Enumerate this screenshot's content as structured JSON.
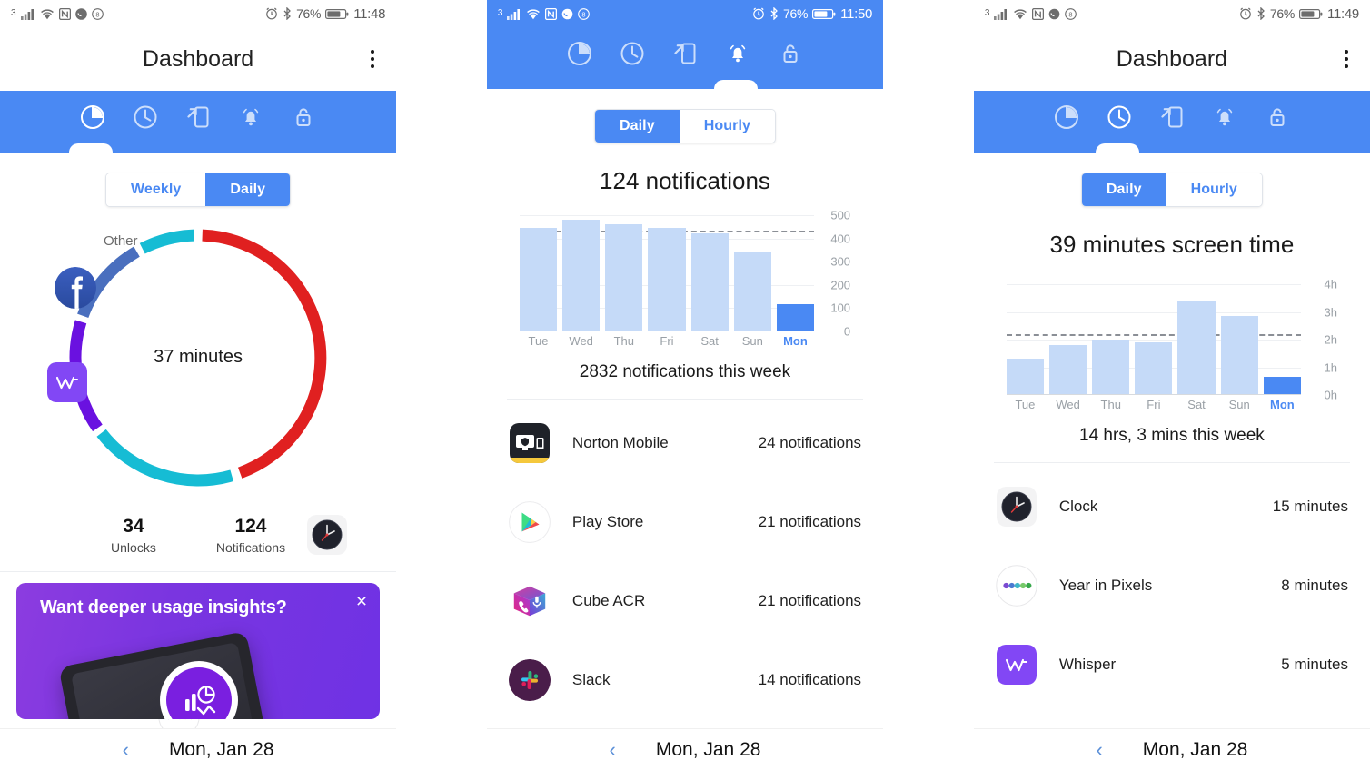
{
  "panels": [
    {
      "id": "usage-overview",
      "statusbar": {
        "sim": "3",
        "battery_pct": "76%",
        "time": "11:48"
      },
      "appbar": {
        "title": "Dashboard"
      },
      "tabs": [
        {
          "name": "pie-chart",
          "label": "Usage"
        },
        {
          "name": "clock",
          "label": "Screen time"
        },
        {
          "name": "phone-unlock",
          "label": "Unlocks"
        },
        {
          "name": "bell",
          "label": "Notifications"
        },
        {
          "name": "lock",
          "label": "Lock"
        }
      ],
      "active_tab": 0,
      "segmented": {
        "options": [
          "Weekly",
          "Daily"
        ],
        "selected": "Daily"
      },
      "donut": {
        "center_label": "37 minutes",
        "other_label": "Other"
      },
      "stats": [
        {
          "value": "34",
          "label": "Unlocks"
        },
        {
          "value": "124",
          "label": "Notifications"
        }
      ],
      "promo": {
        "title": "Want deeper usage insights?",
        "close": "×"
      },
      "datenav": {
        "prev": "‹",
        "date": "Mon, Jan 28"
      }
    },
    {
      "id": "notifications",
      "statusbar": {
        "sim": "3",
        "battery_pct": "76%",
        "time": "11:50"
      },
      "tabs": [
        {
          "name": "pie-chart",
          "label": "Usage"
        },
        {
          "name": "clock",
          "label": "Screen time"
        },
        {
          "name": "phone-unlock",
          "label": "Unlocks"
        },
        {
          "name": "bell",
          "label": "Notifications"
        },
        {
          "name": "lock",
          "label": "Lock"
        }
      ],
      "active_tab": 3,
      "segmented": {
        "options": [
          "Daily",
          "Hourly"
        ],
        "selected": "Daily"
      },
      "headline": "124 notifications",
      "subcaption": "2832 notifications this week",
      "apps": [
        {
          "name": "Norton Mobile",
          "value": "24 notifications",
          "icon": "norton-icon"
        },
        {
          "name": "Play Store",
          "value": "21 notifications",
          "icon": "play-store-icon"
        },
        {
          "name": "Cube ACR",
          "value": "21 notifications",
          "icon": "cube-acr-icon"
        },
        {
          "name": "Slack",
          "value": "14 notifications",
          "icon": "slack-icon"
        }
      ],
      "datenav": {
        "prev": "‹",
        "date": "Mon, Jan 28"
      }
    },
    {
      "id": "screen-time",
      "statusbar": {
        "sim": "3",
        "battery_pct": "76%",
        "time": "11:49"
      },
      "appbar": {
        "title": "Dashboard"
      },
      "tabs": [
        {
          "name": "pie-chart",
          "label": "Usage"
        },
        {
          "name": "clock",
          "label": "Screen time"
        },
        {
          "name": "phone-unlock",
          "label": "Unlocks"
        },
        {
          "name": "bell",
          "label": "Notifications"
        },
        {
          "name": "lock",
          "label": "Lock"
        }
      ],
      "active_tab": 1,
      "segmented": {
        "options": [
          "Daily",
          "Hourly"
        ],
        "selected": "Daily"
      },
      "headline": "39 minutes screen time",
      "subcaption": "14 hrs, 3 mins this week",
      "apps": [
        {
          "name": "Clock",
          "value": "15 minutes",
          "icon": "clock-app-icon"
        },
        {
          "name": "Year in Pixels",
          "value": "8 minutes",
          "icon": "year-in-pixels-icon"
        },
        {
          "name": "Whisper",
          "value": "5 minutes",
          "icon": "whisper-icon"
        }
      ],
      "datenav": {
        "prev": "‹",
        "date": "Mon, Jan 28"
      }
    }
  ],
  "colors": {
    "accent_blue": "#4a89f3",
    "bar_light": "#c5daf8",
    "donut_red": "#e02020",
    "donut_cyan": "#16bcd4",
    "donut_purple": "#6a11e0",
    "donut_blue": "#4a6fbe",
    "promo_purple": "#7a35e0"
  },
  "chart_data": [
    {
      "id": "notifications-weekly",
      "type": "bar",
      "title": "124 notifications",
      "caption": "2832 notifications this week",
      "categories": [
        "Tue",
        "Wed",
        "Thu",
        "Fri",
        "Sat",
        "Sun",
        "Mon"
      ],
      "values": [
        462,
        500,
        480,
        465,
        440,
        355,
        124
      ],
      "highlight_index": 6,
      "average_line": 450,
      "ylabel": "",
      "xlabel": "",
      "yticks": [
        "0",
        "100",
        "200",
        "300",
        "400",
        "500"
      ],
      "ytick_values": [
        0,
        100,
        200,
        300,
        400,
        500
      ],
      "ylim": [
        0,
        520
      ],
      "grid": true,
      "legend": "none"
    },
    {
      "id": "screen-time-weekly",
      "type": "bar",
      "title": "39 minutes screen time",
      "caption": "14 hrs, 3 mins this week",
      "categories": [
        "Tue",
        "Wed",
        "Thu",
        "Fri",
        "Sat",
        "Sun",
        "Mon"
      ],
      "values": [
        1.3,
        1.8,
        2.0,
        1.9,
        3.4,
        2.85,
        0.65
      ],
      "unit": "hours",
      "highlight_index": 6,
      "average_line": 2.2,
      "ylabel": "",
      "xlabel": "",
      "yticks": [
        "0h",
        "1h",
        "2h",
        "3h",
        "4h"
      ],
      "ytick_values": [
        0,
        1,
        2,
        3,
        4
      ],
      "ylim": [
        0,
        4.2
      ],
      "grid": true,
      "legend": "none"
    },
    {
      "id": "usage-donut",
      "type": "pie",
      "title": "37 minutes",
      "labels": [
        "Clock",
        "Year in Pixels",
        "Whisper",
        "Facebook",
        "Other"
      ],
      "values": [
        15,
        8,
        5,
        4,
        3
      ],
      "colors": [
        "#e02020",
        "#16bcd4",
        "#6a11e0",
        "#4a6fbe",
        "#16bcd4"
      ],
      "legend": "around-ring"
    }
  ]
}
